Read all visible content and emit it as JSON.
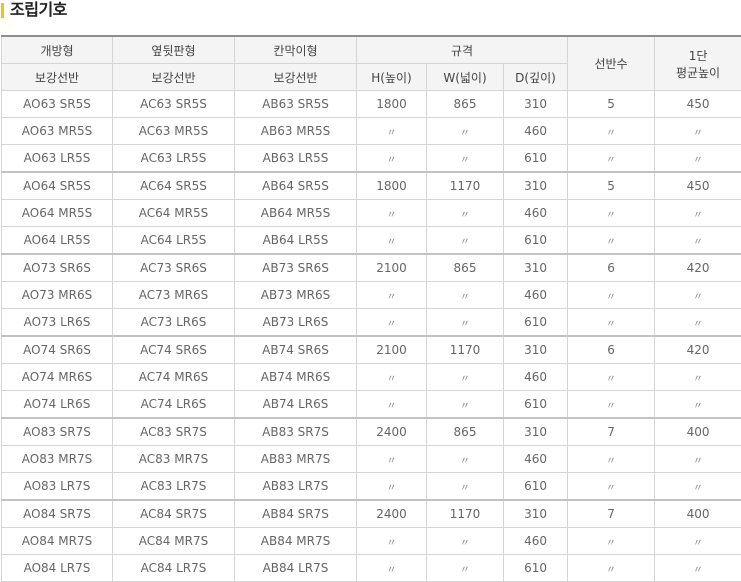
{
  "title": "조립기호",
  "headers": {
    "col1_top": "개방형",
    "col1_bottom": "보강선반",
    "col2_top": "옆뒷판형",
    "col2_bottom": "보강선반",
    "col3_top": "칸막이형",
    "col3_bottom": "보강선반",
    "spec": "규격",
    "h": "H(높이)",
    "w": "W(넓이)",
    "d": "D(깊이)",
    "shelves": "선반수",
    "avg_height_line1": "1단",
    "avg_height_line2": "평균높이"
  },
  "rows": [
    [
      "AO63 SR5S",
      "AC63 SR5S",
      "AB63 SR5S",
      "1800",
      "865",
      "310",
      "5",
      "450"
    ],
    [
      "AO63 MR5S",
      "AC63 MR5S",
      "AB63 MR5S",
      "〃",
      "〃",
      "460",
      "〃",
      "〃"
    ],
    [
      "AO63 LR5S",
      "AC63 LR5S",
      "AB63 LR5S",
      "〃",
      "〃",
      "610",
      "〃",
      "〃"
    ],
    [
      "AO64 SR5S",
      "AC64 SR5S",
      "AB64 SR5S",
      "1800",
      "1170",
      "310",
      "5",
      "450"
    ],
    [
      "AO64 MR5S",
      "AC64 MR5S",
      "AB64 MR5S",
      "〃",
      "〃",
      "460",
      "〃",
      "〃"
    ],
    [
      "AO64 LR5S",
      "AC64 LR5S",
      "AB64 LR5S",
      "〃",
      "〃",
      "610",
      "〃",
      "〃"
    ],
    [
      "AO73 SR6S",
      "AC73 SR6S",
      "AB73 SR6S",
      "2100",
      "865",
      "310",
      "6",
      "420"
    ],
    [
      "AO73 MR6S",
      "AC73 MR6S",
      "AB73 MR6S",
      "〃",
      "〃",
      "460",
      "〃",
      "〃"
    ],
    [
      "AO73 LR6S",
      "AC73 LR6S",
      "AB73 LR6S",
      "〃",
      "〃",
      "610",
      "〃",
      "〃"
    ],
    [
      "AO74 SR6S",
      "AC74 SR6S",
      "AB74 SR6S",
      "2100",
      "1170",
      "310",
      "6",
      "420"
    ],
    [
      "AO74 MR6S",
      "AC74 MR6S",
      "AB74 MR6S",
      "〃",
      "〃",
      "460",
      "〃",
      "〃"
    ],
    [
      "AO74 LR6S",
      "AC74 LR6S",
      "AB74 LR6S",
      "〃",
      "〃",
      "610",
      "〃",
      "〃"
    ],
    [
      "AO83 SR7S",
      "AC83 SR7S",
      "AB83 SR7S",
      "2400",
      "865",
      "310",
      "7",
      "400"
    ],
    [
      "AO83 MR7S",
      "AC83 MR7S",
      "AB83 MR7S",
      "〃",
      "〃",
      "460",
      "〃",
      "〃"
    ],
    [
      "AO83 LR7S",
      "AC83 LR7S",
      "AB83 LR7S",
      "〃",
      "〃",
      "610",
      "〃",
      "〃"
    ],
    [
      "AO84 SR7S",
      "AC84 SR7S",
      "AB84 SR7S",
      "2400",
      "1170",
      "310",
      "7",
      "400"
    ],
    [
      "AO84 MR7S",
      "AC84 MR7S",
      "AB84 MR7S",
      "〃",
      "〃",
      "460",
      "〃",
      "〃"
    ],
    [
      "AO84 LR7S",
      "AC84 LR7S",
      "AB84 LR7S",
      "〃",
      "〃",
      "610",
      "〃",
      "〃"
    ]
  ],
  "colors": {
    "title_accent": "#f6c400",
    "header_bg": "#f4f4f4",
    "border": "#d5d5d5"
  }
}
